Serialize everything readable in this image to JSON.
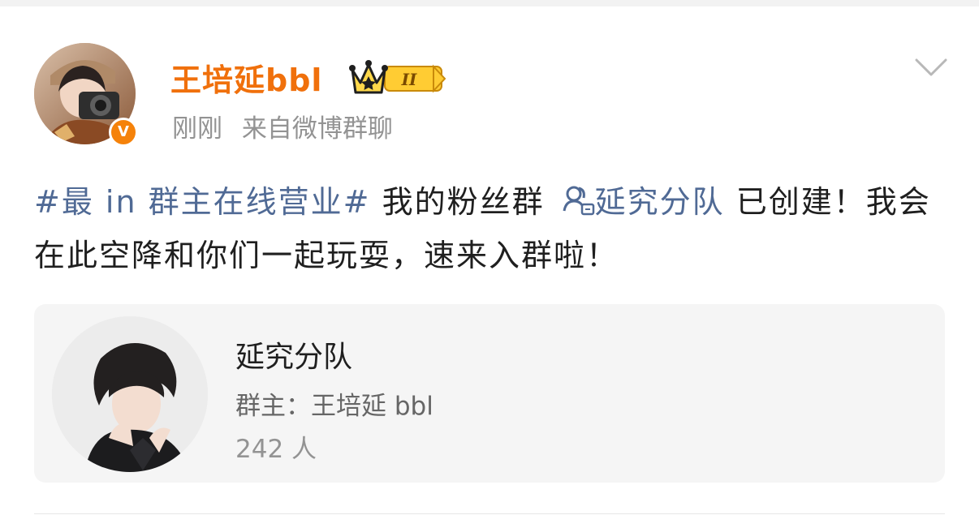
{
  "post": {
    "author": {
      "name": "王培延bbl",
      "verified_badge": "V",
      "level_badge_text": "II"
    },
    "meta": {
      "time": "刚刚",
      "source": "来自微博群聊"
    },
    "content": {
      "hashtag": "#最 in 群主在线营业#",
      "text_before_group": " 我的粉丝群 ",
      "group_link": "延究分队",
      "text_after_group": " 已创建！我会在此空降和你们一起玩耍，速来入群啦！"
    },
    "group_card": {
      "name": "延究分队",
      "owner": "群主：王培延 bbl",
      "members": "242 人"
    }
  },
  "colors": {
    "username": "#f0700c",
    "link": "#506a95",
    "meta_text": "#939393",
    "card_bg": "#f5f5f5",
    "verified": "#f5820a"
  },
  "icons": {
    "menu": "chevron-down-icon",
    "group": "group-chat-icon",
    "crown": "crown-icon"
  }
}
